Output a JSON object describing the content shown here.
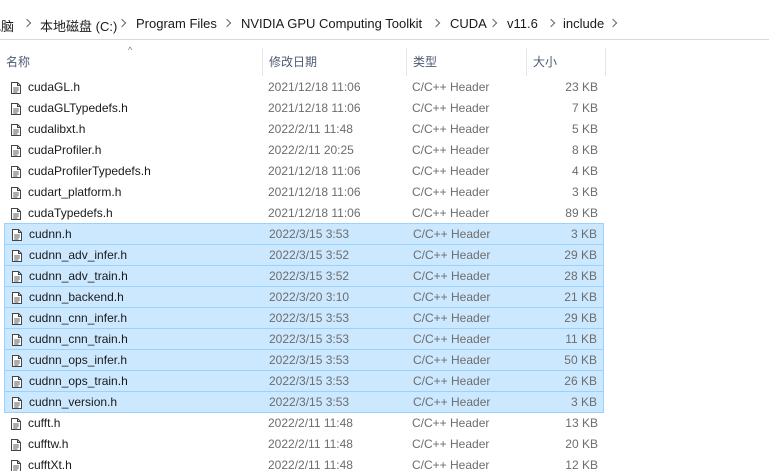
{
  "breadcrumb": [
    {
      "label": "电脑"
    },
    {
      "label": "本地磁盘 (C:)"
    },
    {
      "label": "Program Files"
    },
    {
      "label": "NVIDIA GPU Computing Toolkit"
    },
    {
      "label": "CUDA"
    },
    {
      "label": "v11.6"
    },
    {
      "label": "include"
    }
  ],
  "columns": {
    "name": "名称",
    "date": "修改日期",
    "type": "类型",
    "size": "大小"
  },
  "sort_indicator": "^",
  "files": [
    {
      "name": "cudaGL.h",
      "date": "2021/12/18 11:06",
      "type": "C/C++ Header",
      "size": "23 KB",
      "selected": false
    },
    {
      "name": "cudaGLTypedefs.h",
      "date": "2021/12/18 11:06",
      "type": "C/C++ Header",
      "size": "7 KB",
      "selected": false
    },
    {
      "name": "cudalibxt.h",
      "date": "2022/2/11 11:48",
      "type": "C/C++ Header",
      "size": "5 KB",
      "selected": false
    },
    {
      "name": "cudaProfiler.h",
      "date": "2022/2/11 20:25",
      "type": "C/C++ Header",
      "size": "8 KB",
      "selected": false
    },
    {
      "name": "cudaProfilerTypedefs.h",
      "date": "2021/12/18 11:06",
      "type": "C/C++ Header",
      "size": "4 KB",
      "selected": false
    },
    {
      "name": "cudart_platform.h",
      "date": "2021/12/18 11:06",
      "type": "C/C++ Header",
      "size": "3 KB",
      "selected": false
    },
    {
      "name": "cudaTypedefs.h",
      "date": "2021/12/18 11:06",
      "type": "C/C++ Header",
      "size": "89 KB",
      "selected": false
    },
    {
      "name": "cudnn.h",
      "date": "2022/3/15 3:53",
      "type": "C/C++ Header",
      "size": "3 KB",
      "selected": true
    },
    {
      "name": "cudnn_adv_infer.h",
      "date": "2022/3/15 3:52",
      "type": "C/C++ Header",
      "size": "29 KB",
      "selected": true
    },
    {
      "name": "cudnn_adv_train.h",
      "date": "2022/3/15 3:52",
      "type": "C/C++ Header",
      "size": "28 KB",
      "selected": true
    },
    {
      "name": "cudnn_backend.h",
      "date": "2022/3/20 3:10",
      "type": "C/C++ Header",
      "size": "21 KB",
      "selected": true
    },
    {
      "name": "cudnn_cnn_infer.h",
      "date": "2022/3/15 3:53",
      "type": "C/C++ Header",
      "size": "29 KB",
      "selected": true
    },
    {
      "name": "cudnn_cnn_train.h",
      "date": "2022/3/15 3:53",
      "type": "C/C++ Header",
      "size": "11 KB",
      "selected": true
    },
    {
      "name": "cudnn_ops_infer.h",
      "date": "2022/3/15 3:53",
      "type": "C/C++ Header",
      "size": "50 KB",
      "selected": true
    },
    {
      "name": "cudnn_ops_train.h",
      "date": "2022/3/15 3:53",
      "type": "C/C++ Header",
      "size": "26 KB",
      "selected": true
    },
    {
      "name": "cudnn_version.h",
      "date": "2022/3/15 3:53",
      "type": "C/C++ Header",
      "size": "3 KB",
      "selected": true
    },
    {
      "name": "cufft.h",
      "date": "2022/2/11 11:48",
      "type": "C/C++ Header",
      "size": "13 KB",
      "selected": false
    },
    {
      "name": "cufftw.h",
      "date": "2022/2/11 11:48",
      "type": "C/C++ Header",
      "size": "20 KB",
      "selected": false
    },
    {
      "name": "cufftXt.h",
      "date": "2022/2/11 11:48",
      "type": "C/C++ Header",
      "size": "12 KB",
      "selected": false
    }
  ],
  "colors": {
    "selection_bg": "#cce8ff",
    "selection_border": "#99d1ff",
    "header_text": "#4d5b74"
  },
  "icons": {
    "file": "document-icon",
    "separator": "chevron-right-icon"
  }
}
